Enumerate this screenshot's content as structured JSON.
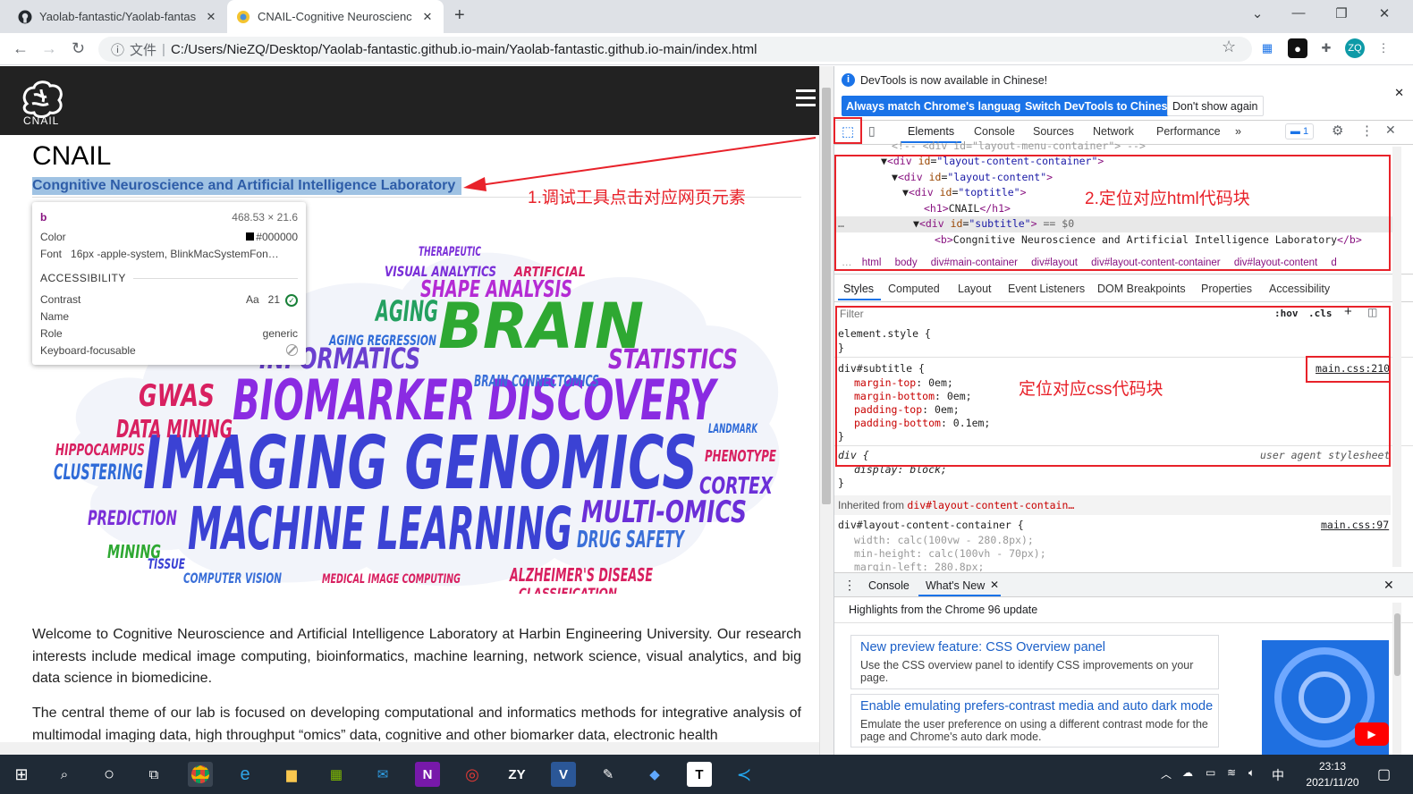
{
  "browser": {
    "tabs": [
      {
        "title": "Yaolab-fantastic/Yaolab-fantas",
        "icon": "github-icon"
      },
      {
        "title": "CNAIL-Cognitive Neuroscienc",
        "icon": "site-favicon-icon"
      }
    ],
    "address": {
      "prefix": "文件",
      "url": "C:/Users/NieZQ/Desktop/Yaolab-fantastic.github.io-main/Yaolab-fantastic.github.io-main/index.html"
    },
    "profile_initials": "ZQ"
  },
  "page": {
    "logo_text": "CNAIL",
    "h1": "CNAIL",
    "subtitle": "Congnitive Neuroscience and Artificial Intelligence Laboratory",
    "paragraph1": "Welcome to Cognitive Neuroscience and Artificial Intelligence Laboratory at Harbin Engineering University. Our research interests include medical image computing, bioinformatics, machine learning, network science, visual analytics, and big data science in biomedicine.",
    "paragraph2": "The central theme of our lab is focused on developing computational and informatics methods for integrative analysis of multimodal imaging data, high throughput “omics” data, cognitive and other biomarker data, electronic health",
    "wordcloud": {
      "large": [
        "IMAGING GENOMICS",
        "MACHINE LEARNING",
        "BIOMARKER DISCOVERY",
        "BRAIN"
      ],
      "medium": [
        "INFORMATICS",
        "STATISTICS",
        "MULTI-OMICS",
        "DRUG SAFETY",
        "AGING",
        "SHAPE ANALYSIS",
        "DATA MINING",
        "GWAS",
        "CLUSTERING",
        "PREDICTION",
        "CORTEX",
        "PHENOTYPE",
        "ALZHEIMER'S DISEASE",
        "BRAIN CONNECTOMICS",
        "AGING REGRESSION",
        "MINING",
        "HIPPOCAMPUS",
        "COMPUTER VISION",
        "MEDICAL IMAGE COMPUTING",
        "CLASSIFICATION",
        "VISUAL ANALYTICS",
        "THERAPEUTIC",
        "ARTIFICIAL",
        "LANDMARK",
        "TISSUE"
      ]
    },
    "annotation_1": "1.调试工具点击对应网页元素"
  },
  "tooltip": {
    "tag": "b",
    "size": "468.53 × 21.6",
    "color_label": "Color",
    "color_value": "#000000",
    "font_label": "Font",
    "font_value": "16px -apple-system, BlinkMacSystemFon…",
    "section": "ACCESSIBILITY",
    "contrast_label": "Contrast",
    "contrast_aa": "Aa",
    "contrast_value": "21",
    "name_label": "Name",
    "role_label": "Role",
    "role_value": "generic",
    "focus_label": "Keyboard-focusable"
  },
  "devtools": {
    "banner_text": "DevTools is now available in Chinese!",
    "btn_match": "Always match Chrome's language",
    "btn_switch": "Switch DevTools to Chinese",
    "btn_dont": "Don't show again",
    "tabs": [
      "Elements",
      "Console",
      "Sources",
      "Network",
      "Performance"
    ],
    "issues_count": "1",
    "annotation_2": "2.定位对应html代码块",
    "annotation_3": "定位对应css代码块",
    "breadcrumbs": [
      "html",
      "body",
      "div#main-container",
      "div#layout",
      "div#layout-content-container",
      "div#layout-content",
      "d"
    ],
    "styles_tabs": [
      "Styles",
      "Computed",
      "Layout",
      "Event Listeners",
      "DOM Breakpoints",
      "Properties",
      "Accessibility"
    ],
    "filter_placeholder": "Filter",
    "hov": ":hov",
    "cls": ".cls",
    "rule1": {
      "selector": "element.style {",
      "close": "}"
    },
    "rule2": {
      "selector": "div#subtitle {",
      "source": "main.css:210",
      "props": [
        {
          "name": "margin-top",
          "value": "0em;"
        },
        {
          "name": "margin-bottom",
          "value": "0em;"
        },
        {
          "name": "padding-top",
          "value": "0em;"
        },
        {
          "name": "padding-bottom",
          "value": "0.1em;"
        }
      ]
    },
    "rule3": {
      "selector": "div {",
      "source": "user agent stylesheet",
      "prop": "display: block;"
    },
    "inherited_label": "Inherited from",
    "inherited_from": "div#layout-content-contain…",
    "rule4": {
      "selector": "div#layout-content-container {",
      "source": "main.css:97",
      "props": [
        {
          "name": "width",
          "value": "calc(100vw - 280.8px);"
        },
        {
          "name": "min-height",
          "value": "calc(100vh - 70px);"
        },
        {
          "name": "margin-left",
          "value": "280.8px;"
        }
      ]
    },
    "drawer_tabs": [
      "Console",
      "What's New"
    ],
    "drawer_heading": "Highlights from the Chrome 96 update",
    "news": [
      {
        "title": "New preview feature: CSS Overview panel",
        "body": "Use the CSS overview panel to identify CSS improvements on your page."
      },
      {
        "title": "Enable emulating prefers-contrast media and auto dark mode",
        "body": "Emulate the user preference on using a different contrast mode for the page and Chrome's auto dark mode."
      }
    ]
  },
  "taskbar": {
    "time": "23:13",
    "date": "2021/11/20",
    "ime": "中"
  }
}
